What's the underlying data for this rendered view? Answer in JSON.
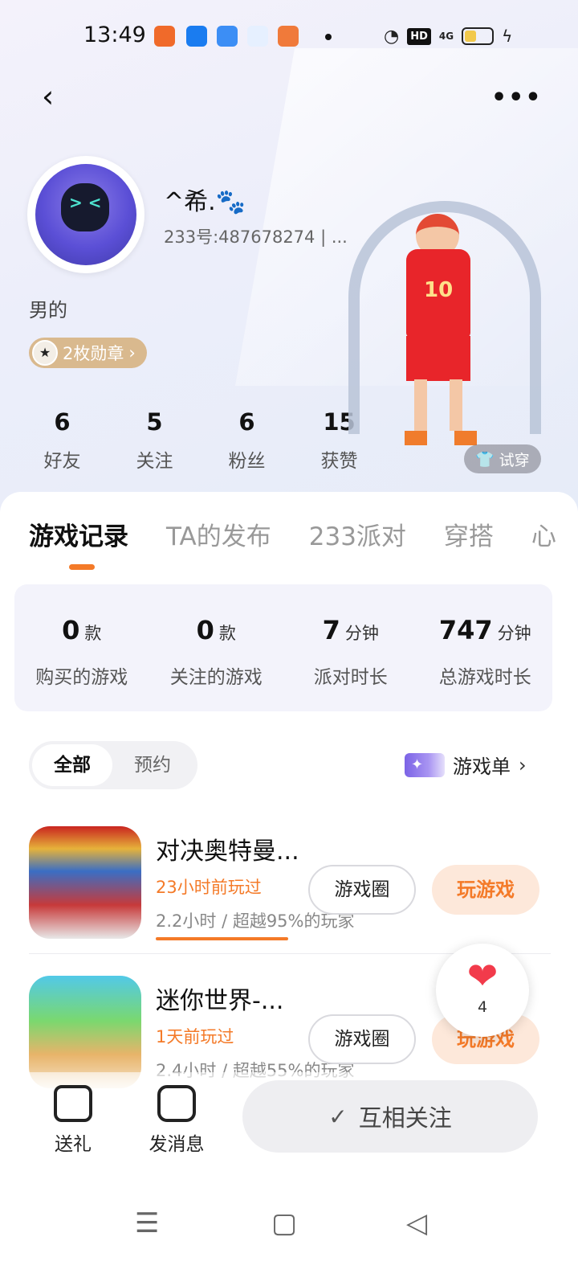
{
  "status_bar": {
    "time": "13:49",
    "hd": "HD",
    "network": "4G"
  },
  "nav": {
    "back_icon": "‹",
    "more_icon": "•••"
  },
  "profile": {
    "nickname": "^希.🐾",
    "uid": "233号:487678274 | ...",
    "gender": "男的",
    "medals": "2枚勋章",
    "medals_chevron": "›"
  },
  "stats": [
    {
      "value": "6",
      "label": "好友"
    },
    {
      "value": "5",
      "label": "关注"
    },
    {
      "value": "6",
      "label": "粉丝"
    },
    {
      "value": "15",
      "label": "获赞"
    }
  ],
  "try_on": "试穿",
  "tabs": [
    "游戏记录",
    "TA的发布",
    "233派对",
    "穿搭",
    "心"
  ],
  "summary": [
    {
      "value": "0",
      "unit": "款",
      "label": "购买的游戏"
    },
    {
      "value": "0",
      "unit": "款",
      "label": "关注的游戏"
    },
    {
      "value": "7",
      "unit": "分钟",
      "label": "派对时长"
    },
    {
      "value": "747",
      "unit": "分钟",
      "label": "总游戏时长"
    }
  ],
  "filter": {
    "all": "全部",
    "reserve": "预约"
  },
  "game_list_link": {
    "label": "游戏单",
    "chevron": "›"
  },
  "games": [
    {
      "title": "对决奥特曼...",
      "played": "23小时前玩过",
      "time": "2.2小时 / 超越95%的玩家",
      "circle_btn": "游戏圈",
      "play_btn": "玩游戏"
    },
    {
      "title": "迷你世界-...",
      "played": "1天前玩过",
      "time": "2.4小时 / 超越55%的玩家",
      "circle_btn": "游戏圈",
      "play_btn": "玩游戏"
    }
  ],
  "like": {
    "icon": "❤",
    "count": "4"
  },
  "bottom": {
    "gift": "送礼",
    "message": "发消息",
    "mutual": "互相关注",
    "check": "✓"
  },
  "sys_nav": {
    "menu": "☰",
    "home": "▢",
    "back": "◁"
  },
  "colors": {
    "accent": "#f47a28",
    "like": "#f23b4b",
    "medal": "#d9b98e"
  }
}
